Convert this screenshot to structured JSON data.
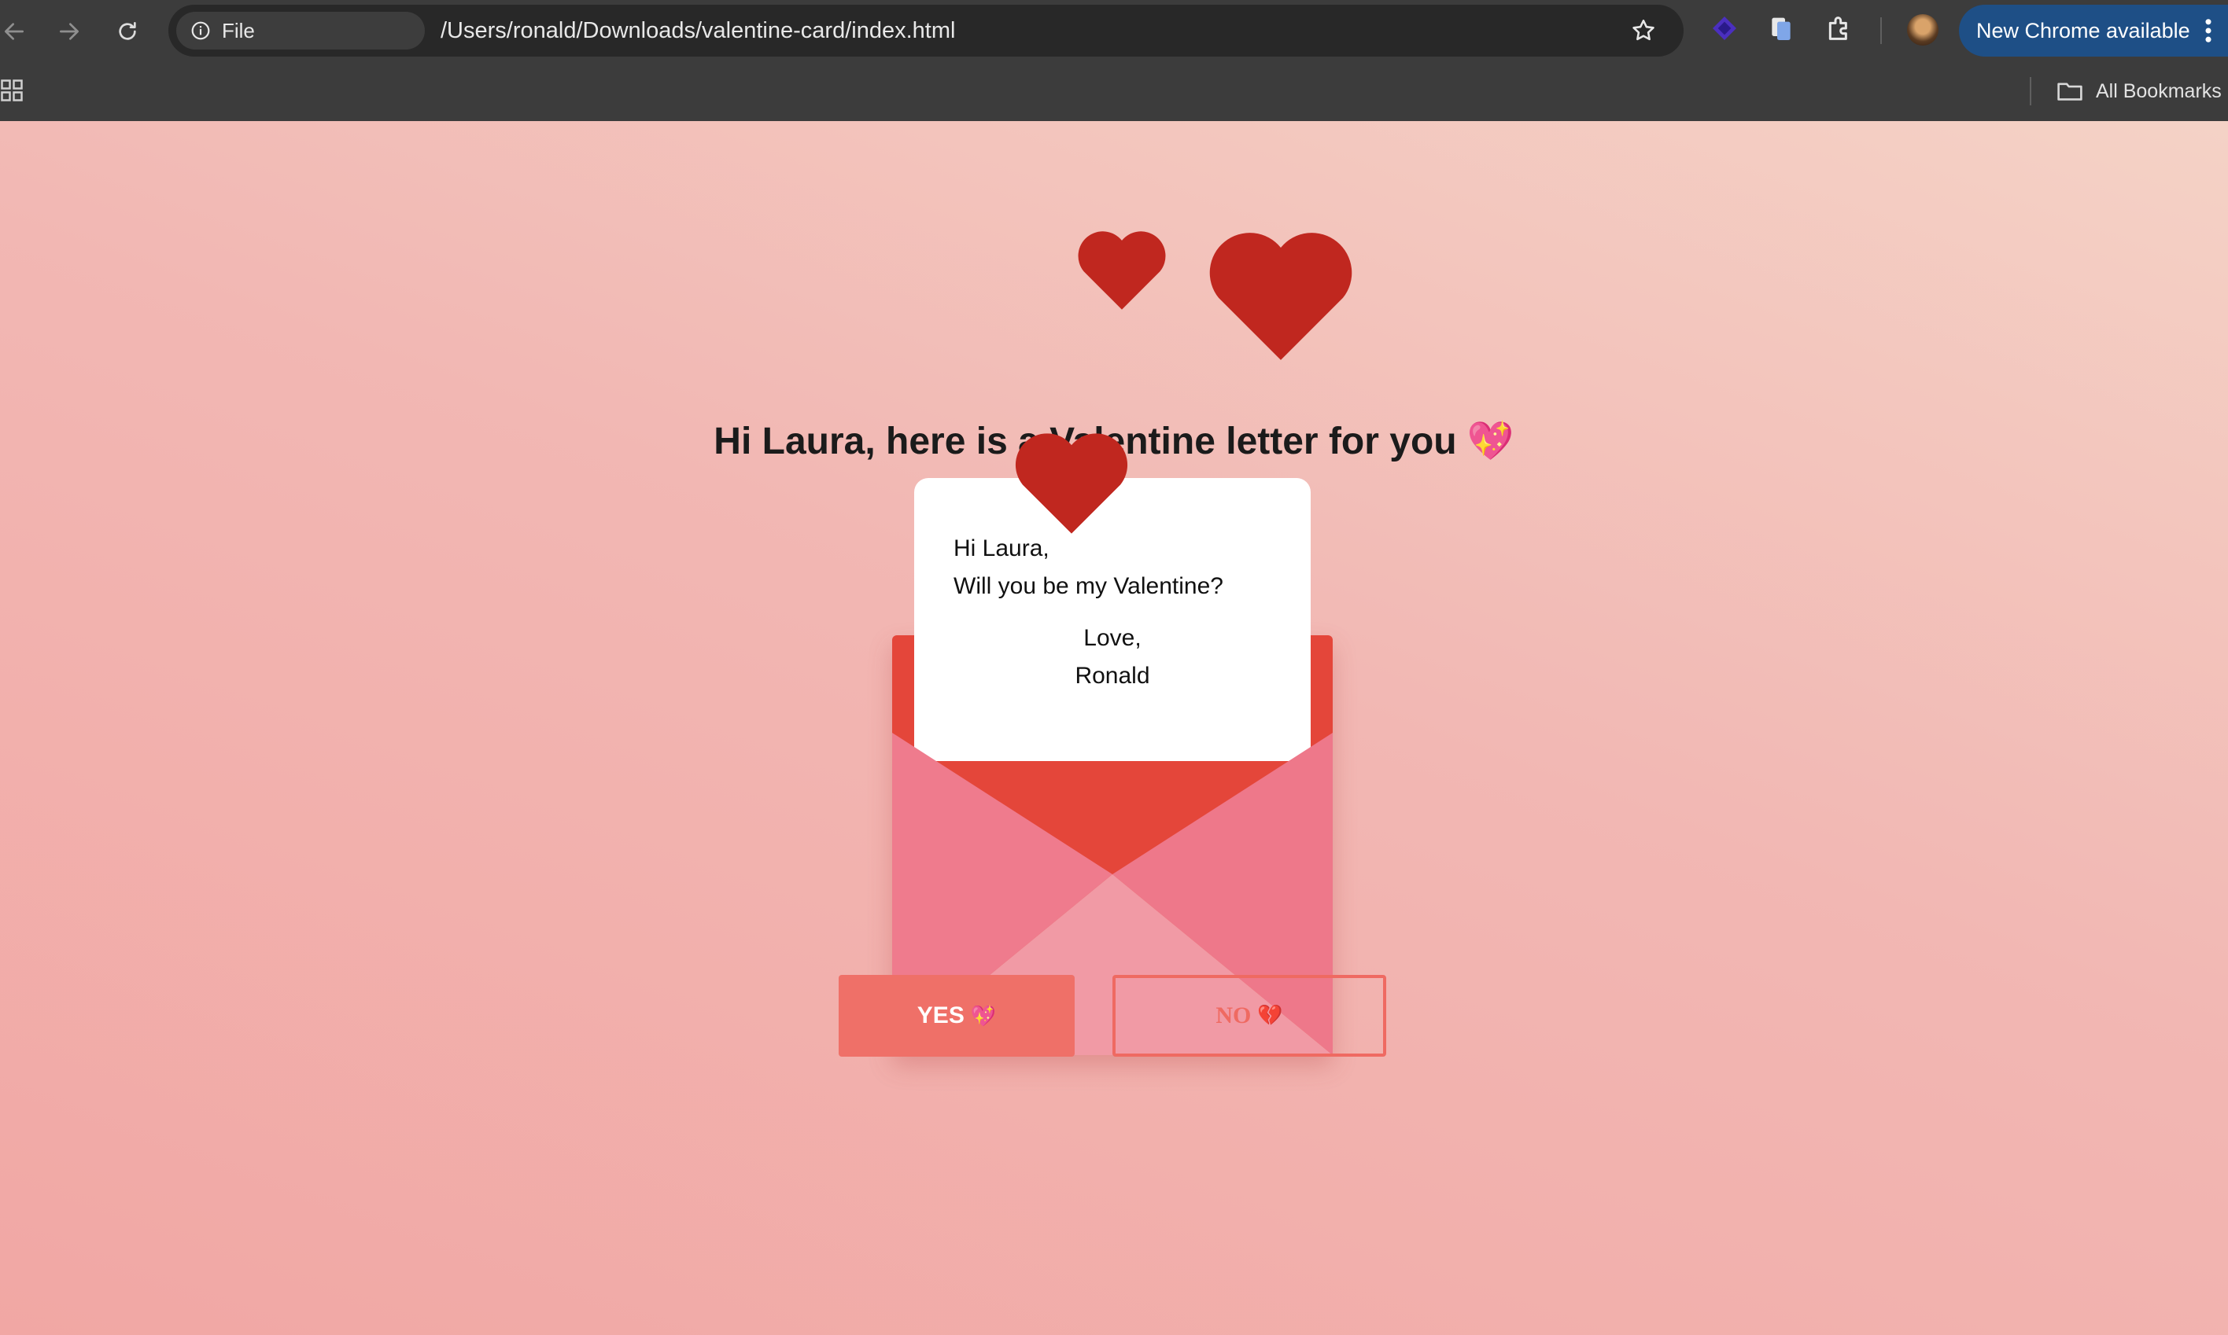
{
  "browser": {
    "site_chip_label": "File",
    "url": "/Users/ronald/Downloads/valentine-card/index.html",
    "update_button_label": "New Chrome available",
    "bookmarks_folder_label": "All Bookmarks"
  },
  "icons": {
    "back": "arrow-left",
    "forward": "arrow-right",
    "reload": "reload",
    "site_info": "info-circle",
    "bookmark_star": "star-outline",
    "extension_1": "layers",
    "extension_2": "document",
    "extensions": "puzzle",
    "menu": "vertical-dots",
    "apps": "grid",
    "folder": "folder"
  },
  "page": {
    "headline": "Hi Laura, here is a Valentine letter for you 💖",
    "letter": {
      "greeting": "Hi Laura,",
      "question": "Will you be my Valentine?",
      "signoff": "Love,",
      "signature": "Ronald"
    },
    "buttons": {
      "yes_label": "YES",
      "yes_emoji": "💖",
      "no_label": "NO",
      "no_emoji": "💔"
    }
  },
  "colors": {
    "heart": "#c0271f",
    "envelope_back": "#e4463a",
    "envelope_sides": "#ef7b8d",
    "envelope_bottom": "#f19aa5",
    "yes_button": "#ef7068",
    "no_button_border": "#ef6a62",
    "update_pill": "#1e4f86"
  }
}
